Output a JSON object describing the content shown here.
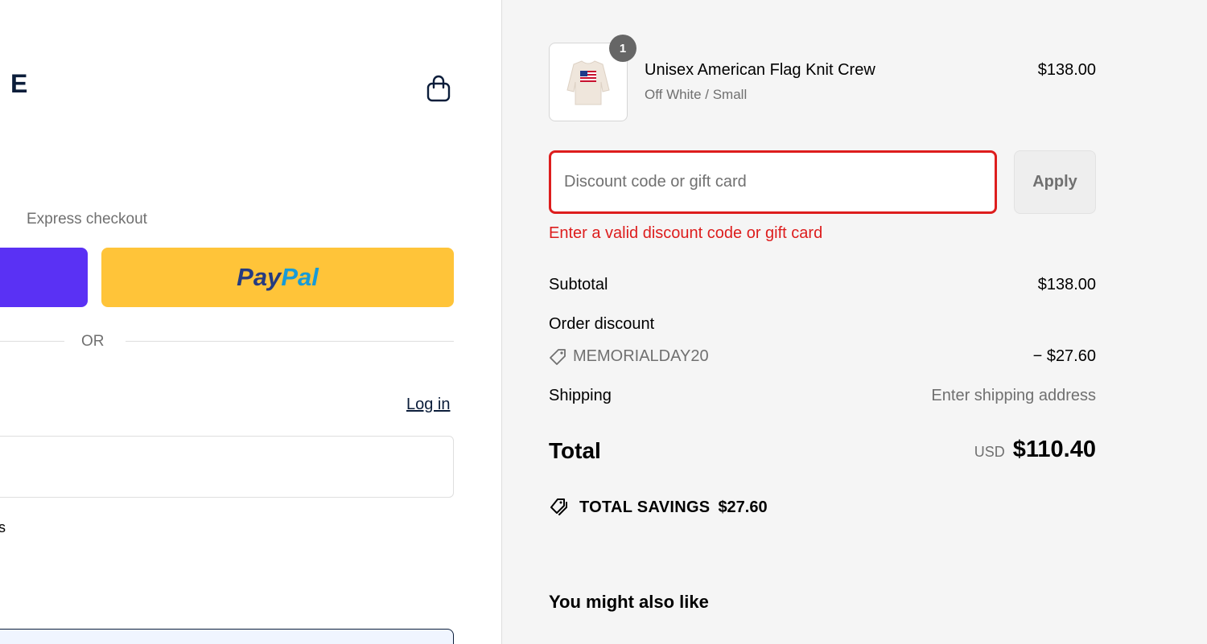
{
  "header": {
    "logo_fragment": "E",
    "cart_icon": "shopping-bag-icon"
  },
  "express": {
    "label": "Express checkout",
    "paypal_pay": "Pay",
    "paypal_pal": "Pal",
    "divider": "OR"
  },
  "contact": {
    "login_label": "Log in",
    "partial_text": "s"
  },
  "order": {
    "item": {
      "name": "Unisex American Flag Knit Crew",
      "variant": "Off White / Small",
      "price": "$138.00",
      "quantity": "1"
    },
    "discount": {
      "placeholder": "Discount code or gift card",
      "apply_label": "Apply",
      "error": "Enter a valid discount code or gift card"
    },
    "summary": {
      "subtotal_label": "Subtotal",
      "subtotal_value": "$138.00",
      "discount_label": "Order discount",
      "discount_code": "MEMORIALDAY20",
      "discount_value": "− $27.60",
      "shipping_label": "Shipping",
      "shipping_value": "Enter shipping address",
      "total_label": "Total",
      "currency": "USD",
      "total_value": "$110.40",
      "savings_label": "TOTAL SAVINGS",
      "savings_value": "$27.60"
    },
    "recommendations_title": "You might also like"
  },
  "colors": {
    "error": "#dd1d1d",
    "paypal_yellow": "#ffc439",
    "shop_purple": "#5a31f4",
    "navy": "#0b1d3a",
    "summary_bg": "#f5f5f5"
  }
}
